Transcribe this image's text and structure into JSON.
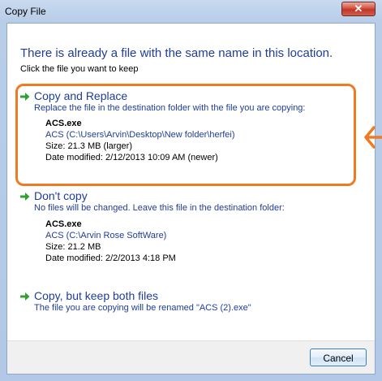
{
  "window": {
    "title": "Copy File",
    "close_glyph": "✕"
  },
  "dialog": {
    "heading": "There is already a file with the same name in this location.",
    "subheading": "Click the file you want to keep"
  },
  "options": [
    {
      "title": "Copy and Replace",
      "description": "Replace the file in the destination folder with the file you are copying:",
      "file": {
        "name": "ACS.exe",
        "location": "ACS (C:\\Users\\Arvin\\Desktop\\New folder\\herfei)",
        "size": "Size: 21.3 MB (larger)",
        "date": "Date modified: 2/12/2013 10:09 AM (newer)"
      }
    },
    {
      "title": "Don't copy",
      "description": "No files will be changed. Leave this file in the destination folder:",
      "file": {
        "name": "ACS.exe",
        "location": "ACS (C:\\Arvin Rose SoftWare)",
        "size": "Size: 21.2 MB",
        "date": "Date modified: 2/2/2013 4:18 PM"
      }
    },
    {
      "title": "Copy, but keep both files",
      "description": "The file you are copying will be renamed \"ACS (2).exe\""
    }
  ],
  "footer": {
    "cancel_label": "Cancel"
  },
  "icons": {
    "option_arrow": "green-arrow-icon",
    "callout_arrow": "orange-arrow-icon"
  },
  "colors": {
    "link_blue": "#1f3d99",
    "highlight_orange": "#f07a22",
    "arrow_green": "#2fa12f"
  }
}
